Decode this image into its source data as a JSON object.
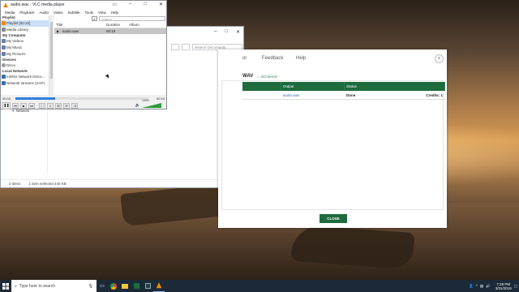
{
  "vlc": {
    "title": "audio.wav - VLC media player",
    "menu": [
      "Media",
      "Playback",
      "Audio",
      "Video",
      "Subtitle",
      "Tools",
      "View",
      "Help"
    ],
    "sidebar": {
      "playlist_heading": "Playlist",
      "playlist_items": [
        "Playlist [00:10]",
        "Media Library"
      ],
      "mycomputer_heading": "My Computer",
      "mycomputer_items": [
        "My Videos",
        "My Music",
        "My Pictures"
      ],
      "devices_heading": "Devices",
      "devices_items": [
        "Discs"
      ],
      "localnet_heading": "Local Network",
      "localnet_items": [
        "mDNS Network Disco...",
        "Network streams (SAP)"
      ]
    },
    "search_placeholder": "Search",
    "columns": [
      "Title",
      "Duration",
      "Album"
    ],
    "rows": [
      {
        "title": "audio.wav",
        "duration": "00:10",
        "album": ""
      }
    ],
    "time_elapsed": "00:03",
    "time_total": "00:10",
    "progress": 0.3,
    "volume": "100%",
    "volume_level": 1.0
  },
  "explorer": {
    "search_placeholder": "Search Documents",
    "status_items": "2 items",
    "status_selected": "1 item selected  440 KB",
    "nav_network": "Network"
  },
  "converter": {
    "nav": [
      "or",
      "Feedback",
      "Help"
    ],
    "heading": "WAV",
    "go_back": "GO BACK",
    "columns": [
      "",
      "Output",
      "Status"
    ],
    "rows": [
      {
        "input": "",
        "output": "audio.wav",
        "status": "Done",
        "credits": "Credits: 1"
      }
    ],
    "close_label": "CLOSE"
  },
  "taskbar": {
    "search_placeholder": "Type here to search",
    "time": "7:29 PM",
    "date": "3/31/2019"
  },
  "colors": {
    "accent_green": "#1e6b3e",
    "vlc_progress": "#2f7fd8",
    "taskbar_bg": "#1c2a38"
  }
}
